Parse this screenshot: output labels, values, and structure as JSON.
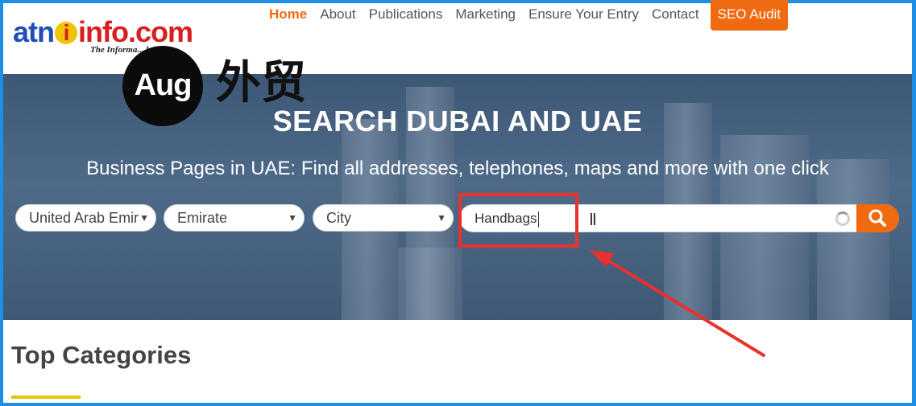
{
  "logo": {
    "part1": "atn",
    "part2": "i",
    "part3": "info.com",
    "tagline": "The Informa... house"
  },
  "nav": {
    "items": [
      "Home",
      "About",
      "Publications",
      "Marketing",
      "Ensure Your Entry",
      "Contact"
    ],
    "cta": "SEO Audit"
  },
  "watermark": {
    "badge": "Aug",
    "text": "外贸"
  },
  "hero": {
    "title": "SEARCH DUBAI AND UAE",
    "subtitle": "Business Pages in UAE: Find all addresses, telephones, maps and more with one click"
  },
  "filters": {
    "country": "United Arab Emir",
    "emirate": "Emirate",
    "city": "City"
  },
  "search": {
    "value": "Handbags"
  },
  "section": {
    "title": "Top Categories"
  },
  "colors": {
    "accent": "#f06a11",
    "annotation": "#e8322b",
    "frame": "#1d8fe6"
  }
}
